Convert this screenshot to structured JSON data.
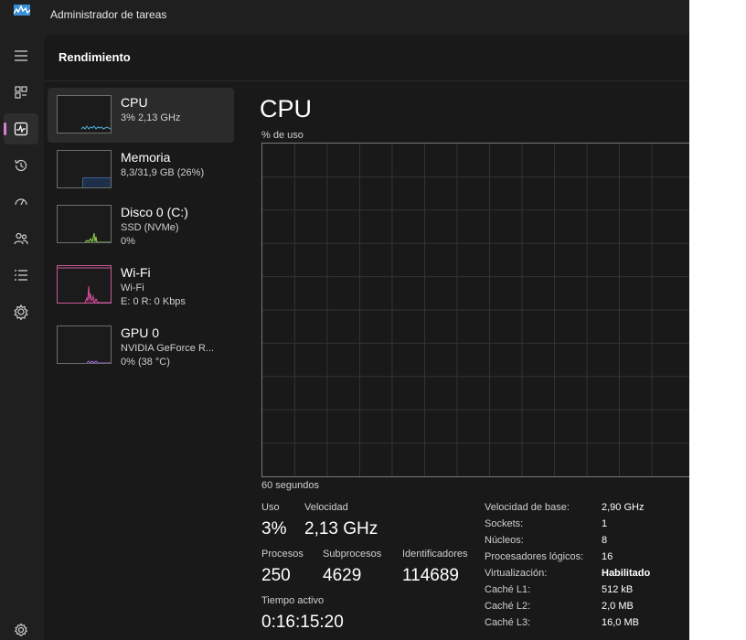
{
  "window": {
    "title": "Administrador de tareas"
  },
  "header": {
    "title": "Rendimiento"
  },
  "nav": [
    "menu-icon",
    "processes-icon",
    "performance-icon",
    "history-icon",
    "startup-icon",
    "users-icon",
    "details-icon",
    "services-icon",
    "settings-icon"
  ],
  "devices": [
    {
      "name": "CPU",
      "sub1": "3%  2,13 GHz",
      "sub2": "",
      "color": "#4fb3d9"
    },
    {
      "name": "Memoria",
      "sub1": "8,3/31,9 GB (26%)",
      "sub2": "",
      "color": "#4f8ed9"
    },
    {
      "name": "Disco 0 (C:)",
      "sub1": "SSD (NVMe)",
      "sub2": "0%",
      "color": "#8fd14f"
    },
    {
      "name": "Wi-Fi",
      "sub1": "Wi-Fi",
      "sub2": "E: 0 R: 0 Kbps",
      "color": "#d14f9a"
    },
    {
      "name": "GPU 0",
      "sub1": "NVIDIA GeForce R...",
      "sub2": "0%  (38 °C)",
      "color": "#a06ad6"
    }
  ],
  "main": {
    "title": "CPU",
    "y_label": "% de uso",
    "x_label": "60 segundos",
    "stats": {
      "usage_label": "Uso",
      "usage_value": "3%",
      "speed_label": "Velocidad",
      "speed_value": "2,13 GHz",
      "processes_label": "Procesos",
      "processes_value": "250",
      "threads_label": "Subprocesos",
      "threads_value": "4629",
      "handles_label": "Identificadores",
      "handles_value": "114689",
      "uptime_label": "Tiempo activo",
      "uptime_value": "0:16:15:20"
    },
    "specs": [
      {
        "key": "Velocidad de base:",
        "value": "2,90 GHz"
      },
      {
        "key": "Sockets:",
        "value": "1"
      },
      {
        "key": "Núcleos:",
        "value": "8"
      },
      {
        "key": "Procesadores lógicos:",
        "value": "16"
      },
      {
        "key": "Virtualización:",
        "value": "Habilitado"
      },
      {
        "key": "Caché L1:",
        "value": "512 kB"
      },
      {
        "key": "Caché L2:",
        "value": "2,0 MB"
      },
      {
        "key": "Caché L3:",
        "value": "16,0 MB"
      }
    ]
  },
  "colors": {
    "background": "#1f1f1f",
    "panel": "#191919",
    "accent": "#d67fd3"
  }
}
